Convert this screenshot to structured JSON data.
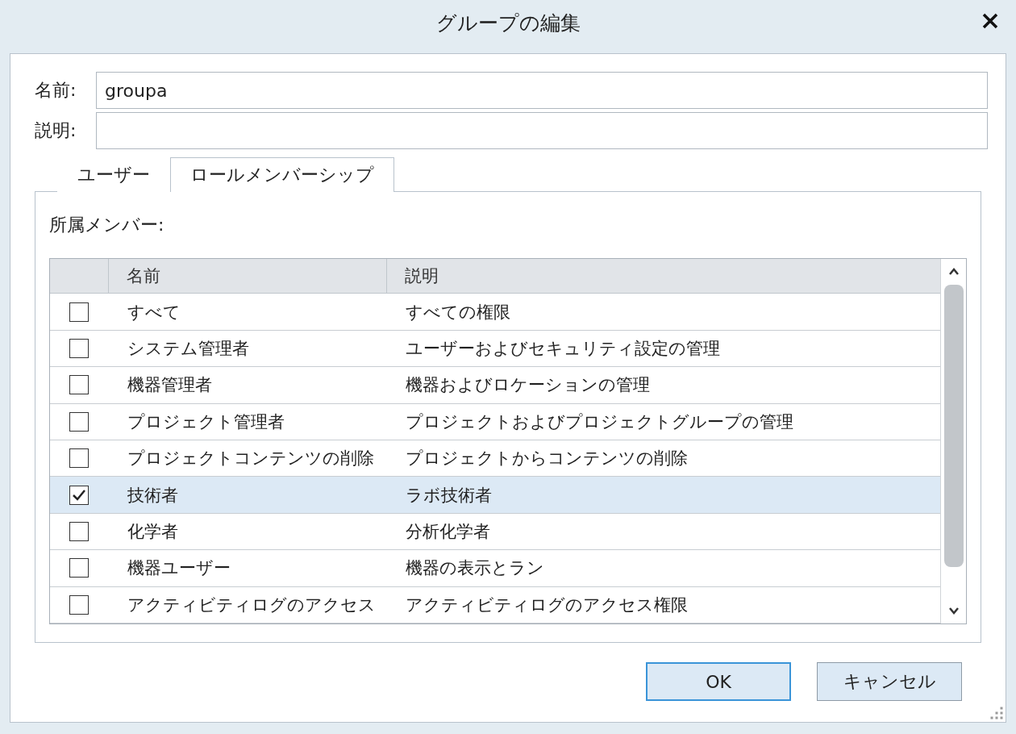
{
  "window": {
    "title": "グループの編集"
  },
  "fields": [
    {
      "label": "名前:",
      "value": "groupa"
    },
    {
      "label": "説明:"
    }
  ],
  "tabs": [
    {
      "label": "ユーザー",
      "selected": false
    },
    {
      "label": "ロールメンバーシップ",
      "selected": true
    }
  ],
  "members_label": "所属メンバー:",
  "table": {
    "columns": [
      "名前",
      "説明"
    ],
    "rows": [
      {
        "checked": false,
        "selected": false,
        "name": "すべて",
        "description": "すべての権限"
      },
      {
        "checked": false,
        "selected": false,
        "name": "システム管理者",
        "description": "ユーザーおよびセキュリティ設定の管理"
      },
      {
        "checked": false,
        "selected": false,
        "name": "機器管理者",
        "description": "機器およびロケーションの管理"
      },
      {
        "checked": false,
        "selected": false,
        "name": "プロジェクト管理者",
        "description": "プロジェクトおよびプロジェクトグループの管理"
      },
      {
        "checked": false,
        "selected": false,
        "name": "プロジェクトコンテンツの削除",
        "description": "プロジェクトからコンテンツの削除"
      },
      {
        "checked": true,
        "selected": true,
        "name": "技術者",
        "description": "ラボ技術者"
      },
      {
        "checked": false,
        "selected": false,
        "name": "化学者",
        "description": "分析化学者"
      },
      {
        "checked": false,
        "selected": false,
        "name": "機器ユーザー",
        "description": "機器の表示とラン"
      },
      {
        "checked": false,
        "selected": false,
        "name": "アクティビティログのアクセス",
        "description": "アクティビティログのアクセス権限"
      }
    ]
  },
  "buttons": [
    {
      "label": "OK",
      "default": true
    },
    {
      "label": "キャンセル",
      "default": false
    }
  ]
}
